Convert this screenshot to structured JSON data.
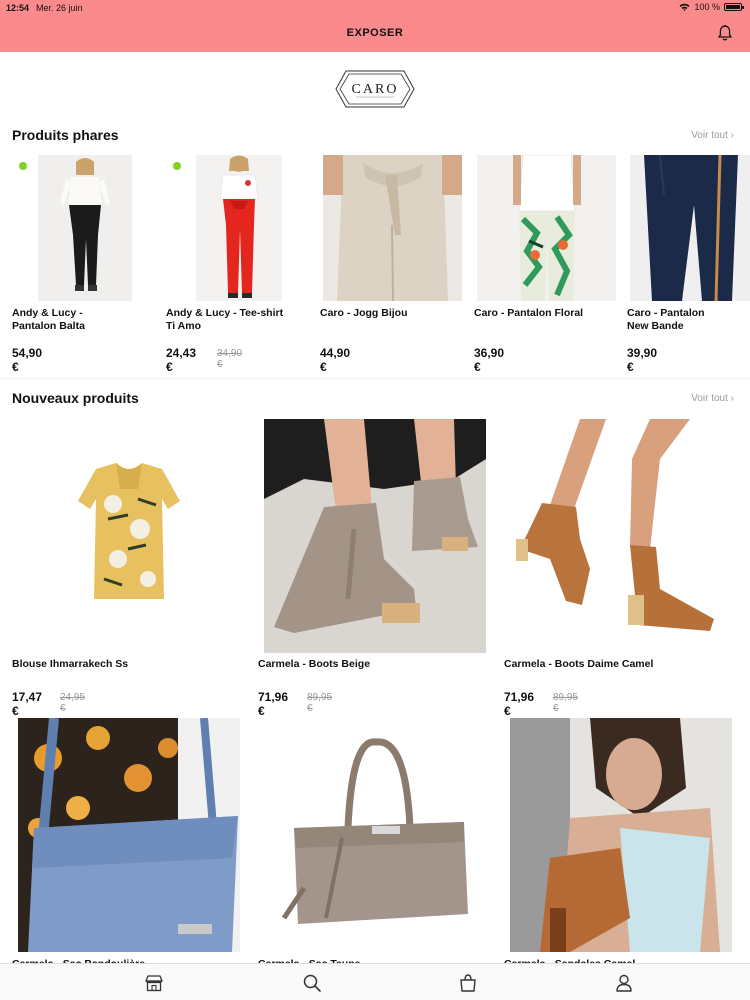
{
  "status": {
    "time": "12:54",
    "date": "Mer. 26 juin",
    "battery": "100 %"
  },
  "nav": {
    "title": "EXPOSER"
  },
  "logo": {
    "text": "CARO"
  },
  "featured": {
    "title": "Produits phares",
    "see_all": "Voir tout",
    "items": [
      {
        "name_line1": "Andy & Lucy -",
        "name_line2": "Pantalon Balta",
        "price": "54,90 €",
        "old_price": ""
      },
      {
        "name_line1": "Andy & Lucy - Tee-shirt",
        "name_line2": "Ti Amo",
        "price": "24,43 €",
        "old_price": "34,90 €"
      },
      {
        "name_line1": "Caro - Jogg Bijou",
        "name_line2": "",
        "price": "44,90 €",
        "old_price": ""
      },
      {
        "name_line1": "Caro - Pantalon Floral",
        "name_line2": "",
        "price": "36,90 €",
        "old_price": ""
      },
      {
        "name_line1": "Caro - Pantalon",
        "name_line2": "New Bande",
        "price": "39,90 €",
        "old_price": ""
      }
    ]
  },
  "new_products": {
    "title": "Nouveaux produits",
    "see_all": "Voir tout",
    "items": [
      {
        "name": "Blouse Ihmarrakech Ss",
        "price": "17,47 €",
        "old_price": "24,95 €"
      },
      {
        "name": "Carmela - Boots Beige",
        "price": "71,96 €",
        "old_price": "89,95 €"
      },
      {
        "name": "Carmela - Boots Daime Camel",
        "price": "71,96 €",
        "old_price": "89,95 €"
      },
      {
        "name": "Carmela - Sac Bandoulière",
        "price": "",
        "old_price": ""
      },
      {
        "name": "Carmela - Sac Taupe",
        "price": "",
        "old_price": ""
      },
      {
        "name": "Carmela - Sandales Camel",
        "price": "",
        "old_price": ""
      }
    ]
  },
  "tabbar": {
    "icons": [
      "store-icon",
      "search-icon",
      "bag-icon",
      "user-icon"
    ]
  },
  "colors": {
    "header": "#fb8a8c",
    "dot_green": "#7ed321",
    "dot_red": "#e5453b"
  }
}
